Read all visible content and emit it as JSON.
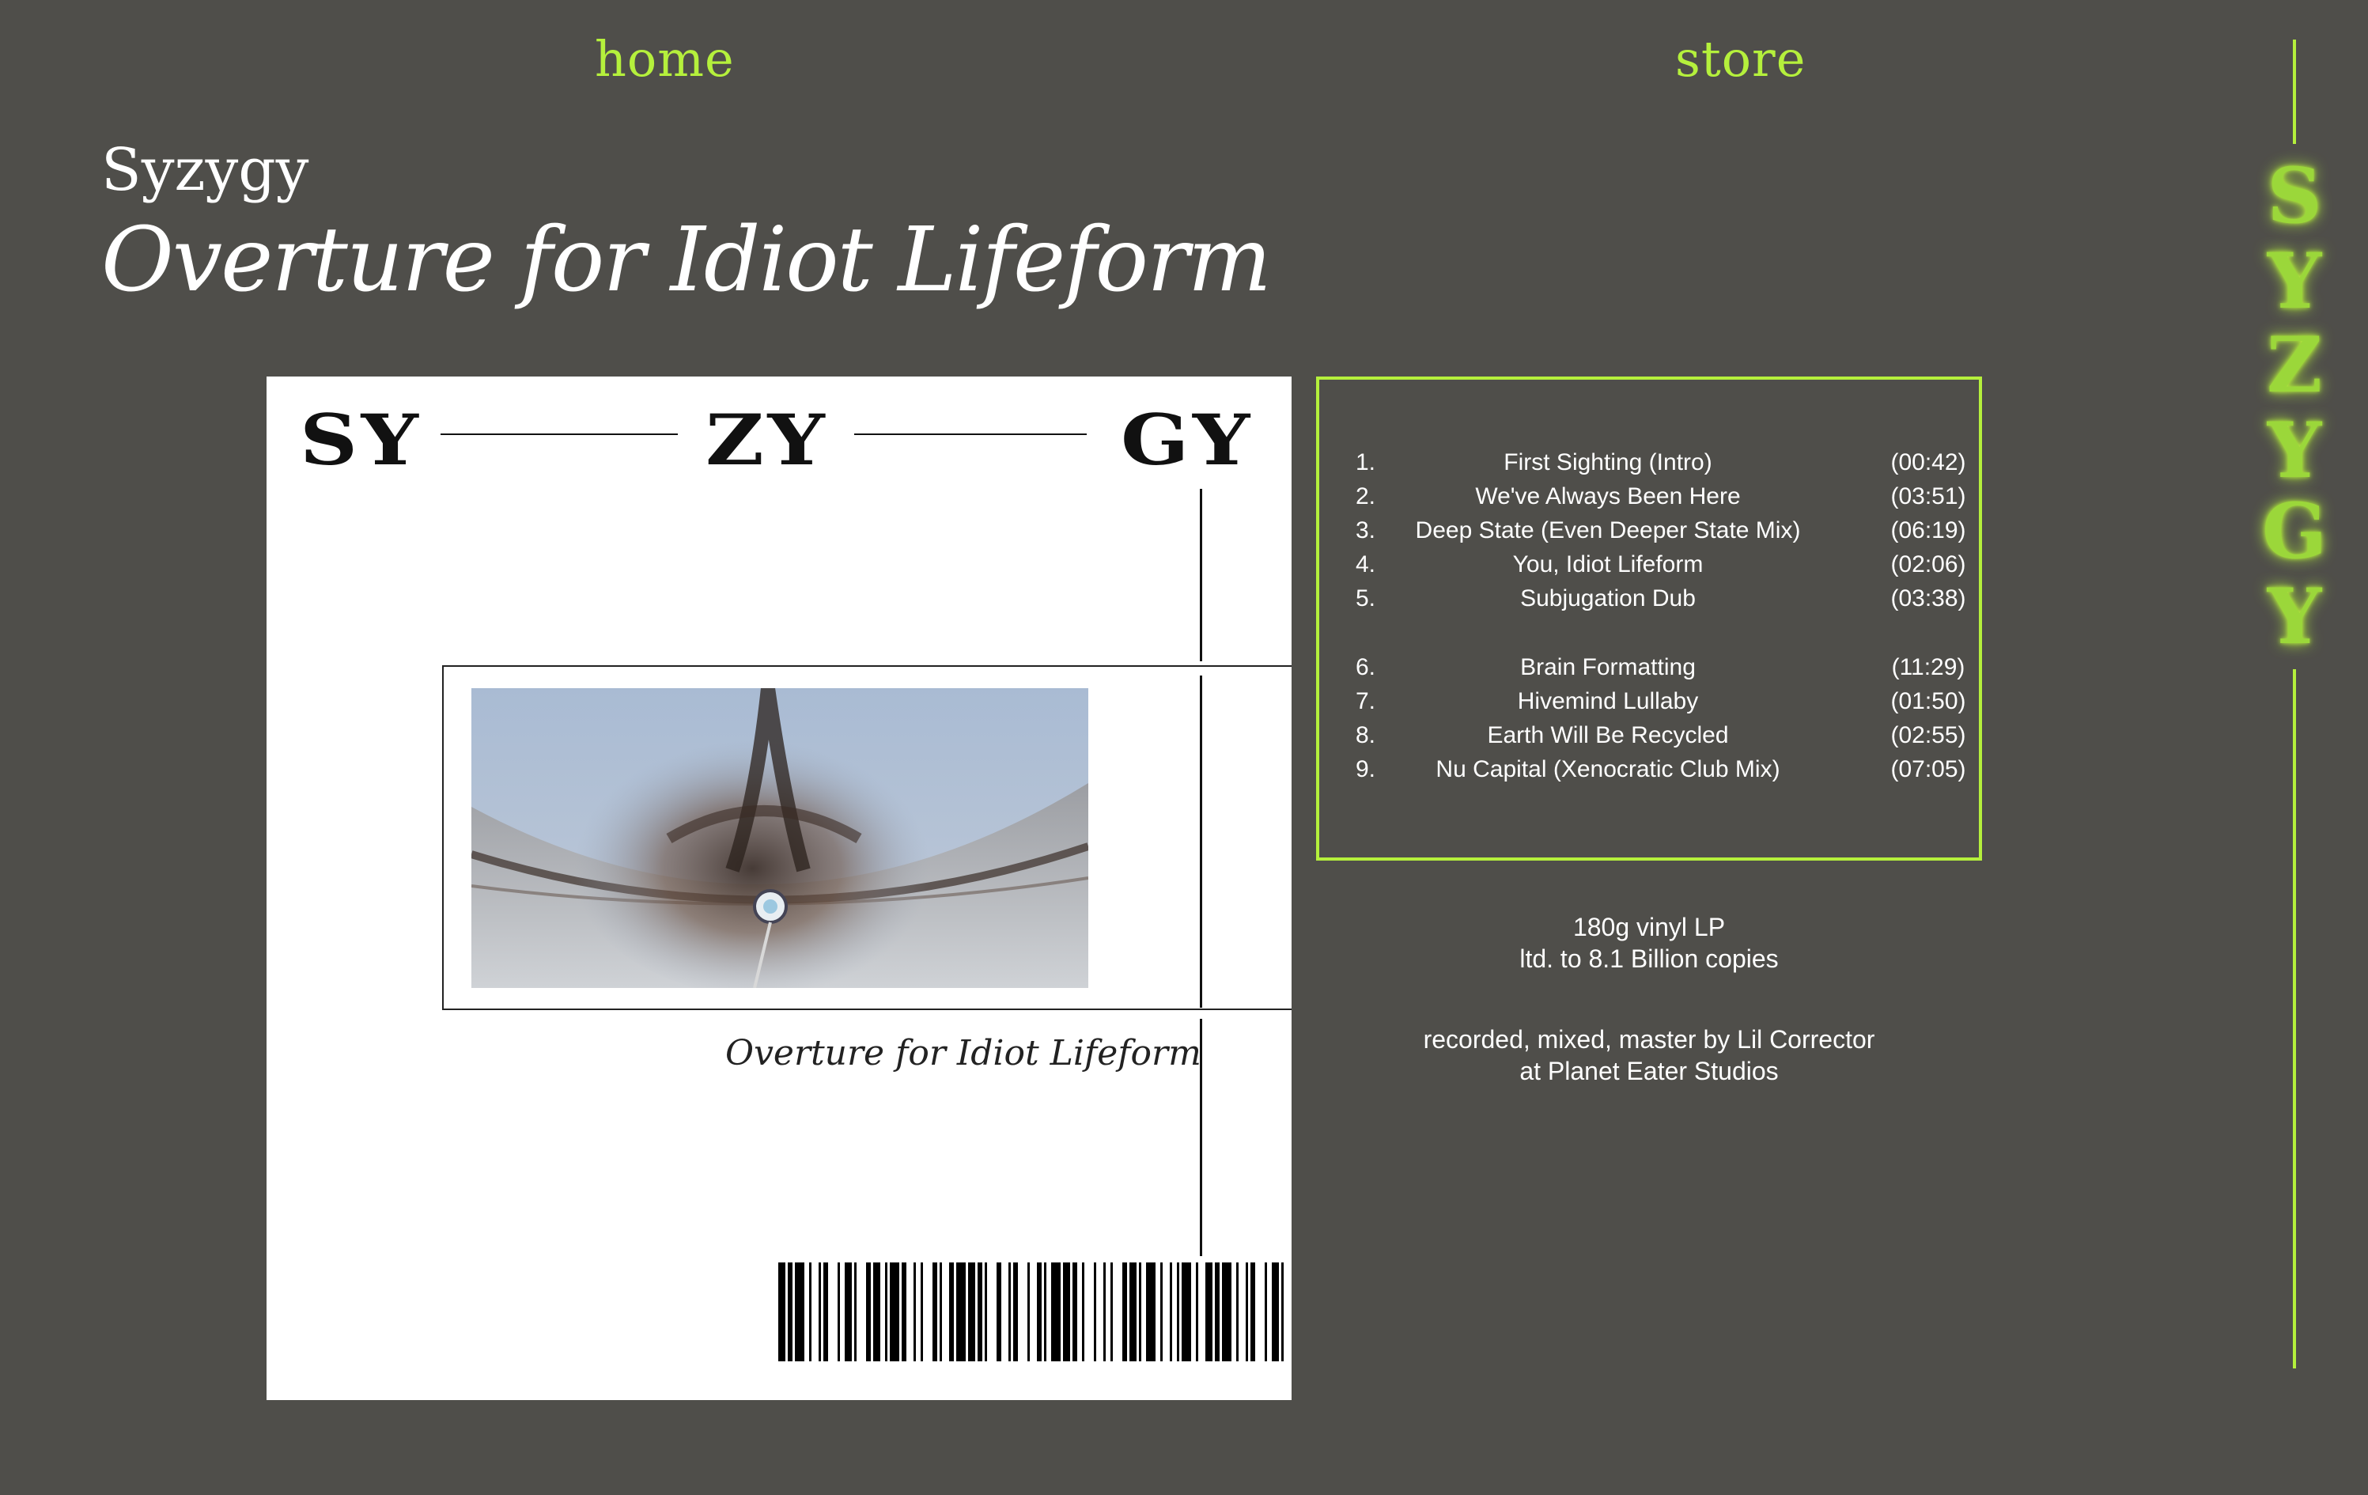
{
  "nav": {
    "home": "home",
    "store": "store"
  },
  "header": {
    "artist": "Syzygy",
    "album_title": "Overture for Idiot Lifeform"
  },
  "cover": {
    "syllables": [
      "SY",
      "ZY",
      "GY"
    ],
    "caption": "Overture for Idiot Lifeform"
  },
  "tracklist": [
    {
      "num": "1.",
      "title": "First Sighting (Intro)",
      "duration": "(00:42)"
    },
    {
      "num": "2.",
      "title": "We've Always Been Here",
      "duration": "(03:51)"
    },
    {
      "num": "3.",
      "title": "Deep State (Even Deeper State Mix)",
      "duration": "(06:19)"
    },
    {
      "num": "4.",
      "title": "You, Idiot Lifeform",
      "duration": "(02:06)"
    },
    {
      "num": "5.",
      "title": "Subjugation Dub",
      "duration": "(03:38)"
    },
    {
      "num": "6.",
      "title": "Brain Formatting",
      "duration": "(11:29)"
    },
    {
      "num": "7.",
      "title": "Hivemind Lullaby",
      "duration": "(01:50)"
    },
    {
      "num": "8.",
      "title": "Earth Will Be Recycled",
      "duration": "(02:55)"
    },
    {
      "num": "9.",
      "title": "Nu Capital (Xenocratic Club Mix)",
      "duration": "(07:05)"
    }
  ],
  "info": {
    "format": "180g vinyl LP",
    "limited": "ltd. to 8.1 Billion copies",
    "credits_line1": "recorded, mixed, master by Lil Corrector",
    "credits_line2": "at Planet Eater Studios"
  },
  "side_logo": {
    "letters": [
      "S",
      "Y",
      "Z",
      "Y",
      "G",
      "Y"
    ]
  },
  "colors": {
    "background": "#4f4e4a",
    "accent": "#b5f03c",
    "text": "#ffffff"
  }
}
